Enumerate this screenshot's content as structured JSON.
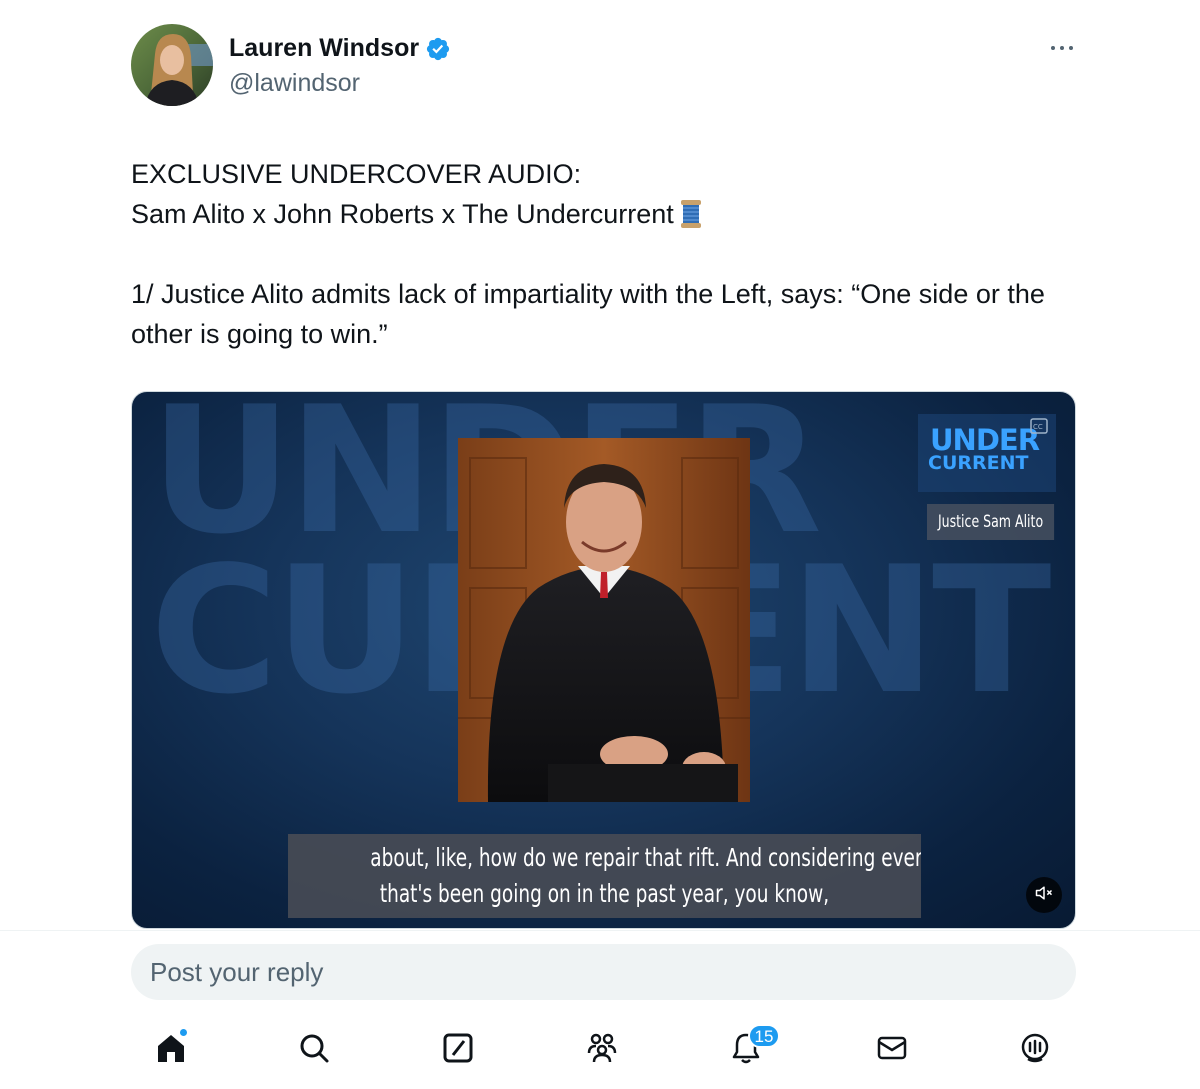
{
  "author": {
    "display_name": "Lauren Windsor",
    "handle": "@lawindsor",
    "verified": true
  },
  "tweet": {
    "line1": "EXCLUSIVE UNDERCOVER AUDIO:",
    "line2": "Sam Alito x John Roberts x The Undercurrent",
    "line2_emoji": "spool-of-thread-icon",
    "line3": "1/ Justice Alito admits lack of impartiality with the Left, says: “One side or the other is going to win.”"
  },
  "media": {
    "brand_top": "UNDER",
    "brand_bottom": "CURRENT",
    "lower_third": "Justice Sam Alito",
    "caption_line1": "about, like, how do we repair that rift. And considering everything",
    "caption_line2": "that's been going on in the past year, you know,",
    "background_watermark_top": "UNDER",
    "background_watermark_bottom": "CURRENT"
  },
  "reply": {
    "placeholder": "Post your reply"
  },
  "nav": {
    "items": [
      "home-icon",
      "search-icon",
      "grok-icon",
      "communities-icon",
      "notifications-icon",
      "messages-icon",
      "spaces-icon"
    ],
    "notifications_count": "15"
  },
  "colors": {
    "accent": "#1d9bf0",
    "text": "#0f1419",
    "secondary_text": "#536471",
    "media_bg": "#0b2240"
  }
}
